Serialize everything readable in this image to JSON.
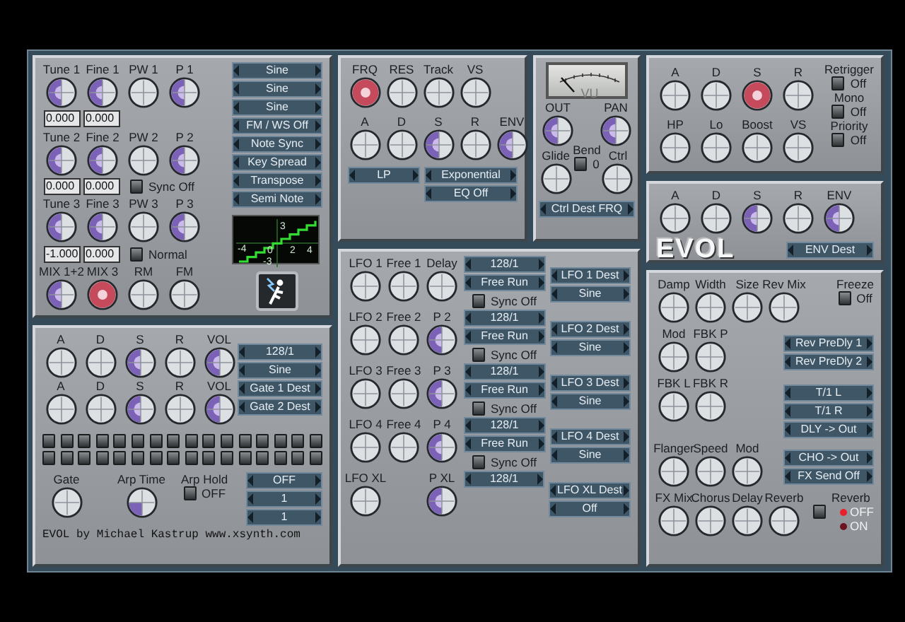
{
  "oscillator": {
    "rows": [
      {
        "knobs": [
          {
            "label": "Tune 1",
            "kind": "half"
          },
          {
            "label": "Fine 1",
            "kind": "half"
          },
          {
            "label": "PW 1",
            "kind": "plain"
          },
          {
            "label": "P 1",
            "kind": "half"
          }
        ],
        "values": [
          "0.000",
          "0.000"
        ]
      },
      {
        "knobs": [
          {
            "label": "Tune 2",
            "kind": "half"
          },
          {
            "label": "Fine 2",
            "kind": "half"
          },
          {
            "label": "PW 2",
            "kind": "plain"
          },
          {
            "label": "P 2",
            "kind": "half"
          }
        ],
        "values": [
          "0.000",
          "0.000"
        ],
        "toggle": {
          "state": "Sync Off",
          "checked": false
        }
      },
      {
        "knobs": [
          {
            "label": "Tune 3",
            "kind": "half"
          },
          {
            "label": "Fine 3",
            "kind": "half"
          },
          {
            "label": "PW 3",
            "kind": "plain"
          },
          {
            "label": "P 3",
            "kind": "half"
          }
        ],
        "values": [
          "-1.000",
          "0.000"
        ],
        "toggle": {
          "state": "Normal",
          "checked": false
        }
      },
      {
        "knobs": [
          {
            "label": "MIX 1+2",
            "kind": "half"
          },
          {
            "label": "MIX 3",
            "kind": "red"
          },
          {
            "label": "RM",
            "kind": "plain"
          },
          {
            "label": "FM",
            "kind": "plain"
          }
        ]
      }
    ],
    "selectors": [
      "Sine",
      "Sine",
      "Sine",
      "FM / WS Off",
      "Note Sync",
      "Key Spread",
      "Transpose",
      "Semi Note"
    ],
    "scope": {
      "labels": [
        "-4",
        "3",
        "0",
        "-3",
        "2",
        "4"
      ]
    }
  },
  "filter": {
    "knob_rows": [
      [
        {
          "label": "FRQ",
          "kind": "red"
        },
        {
          "label": "RES",
          "kind": "plain"
        },
        {
          "label": "Track",
          "kind": "plain"
        },
        {
          "label": "VS",
          "kind": "plain"
        }
      ],
      [
        {
          "label": "A",
          "kind": "plain"
        },
        {
          "label": "D",
          "kind": "plain"
        },
        {
          "label": "S",
          "kind": "half"
        },
        {
          "label": "R",
          "kind": "plain"
        },
        {
          "label": "ENV",
          "kind": "half"
        }
      ]
    ],
    "selectors": [
      "LP",
      "Exponential",
      "EQ Off"
    ]
  },
  "output": {
    "meter_label": "VU",
    "knobs": [
      {
        "label": "OUT",
        "kind": "half"
      },
      {
        "label": "PAN",
        "kind": "half"
      },
      {
        "label": "Glide",
        "kind": "plain"
      },
      {
        "label": "Ctrl",
        "kind": "plain"
      }
    ],
    "bend": {
      "label": "Bend",
      "state": "0",
      "checked": false
    },
    "selector": "Ctrl Dest FRQ"
  },
  "envelope": {
    "knob_rows": [
      [
        {
          "label": "A",
          "kind": "plain"
        },
        {
          "label": "D",
          "kind": "plain"
        },
        {
          "label": "S",
          "kind": "red"
        },
        {
          "label": "R",
          "kind": "plain"
        }
      ],
      [
        {
          "label": "HP",
          "kind": "plain"
        },
        {
          "label": "Lo",
          "kind": "plain"
        },
        {
          "label": "Boost",
          "kind": "plain"
        },
        {
          "label": "VS",
          "kind": "plain"
        }
      ]
    ],
    "toggles": [
      {
        "label": "Retrigger",
        "state": "Off",
        "checked": false
      },
      {
        "label": "Mono",
        "state": "Off",
        "checked": false
      },
      {
        "label": "Priority",
        "state": "Off",
        "checked": false
      }
    ]
  },
  "evol": {
    "knobs": [
      {
        "label": "A",
        "kind": "plain"
      },
      {
        "label": "D",
        "kind": "plain"
      },
      {
        "label": "S",
        "kind": "half"
      },
      {
        "label": "R",
        "kind": "plain"
      },
      {
        "label": "ENV",
        "kind": "half"
      }
    ],
    "logo": "EVOL",
    "selector": "ENV Dest"
  },
  "lfo": {
    "rows": [
      {
        "knobs": [
          {
            "label": "LFO 1",
            "kind": "plain"
          },
          {
            "label": "Free 1",
            "kind": "plain"
          },
          {
            "label": "Delay",
            "kind": "plain"
          }
        ],
        "rate": "128/1",
        "mode": "Free Run",
        "sync": {
          "state": "Sync Off",
          "checked": false
        },
        "dest": "LFO 1 Dest",
        "wave": "Sine"
      },
      {
        "knobs": [
          {
            "label": "LFO 2",
            "kind": "plain"
          },
          {
            "label": "Free 2",
            "kind": "plain"
          },
          {
            "label": "P 2",
            "kind": "half"
          }
        ],
        "rate": "128/1",
        "mode": "Free Run",
        "sync": {
          "state": "Sync Off",
          "checked": false
        },
        "dest": "LFO 2 Dest",
        "wave": "Sine"
      },
      {
        "knobs": [
          {
            "label": "LFO 3",
            "kind": "plain"
          },
          {
            "label": "Free 3",
            "kind": "plain"
          },
          {
            "label": "P 3",
            "kind": "half"
          }
        ],
        "rate": "128/1",
        "mode": "Free Run",
        "sync": {
          "state": "Sync Off",
          "checked": false
        },
        "dest": "LFO 3 Dest",
        "wave": "Sine"
      },
      {
        "knobs": [
          {
            "label": "LFO 4",
            "kind": "plain"
          },
          {
            "label": "Free 4",
            "kind": "plain"
          },
          {
            "label": "P 4",
            "kind": "half"
          }
        ],
        "rate": "128/1",
        "mode": "Free Run",
        "sync": {
          "state": "Sync Off",
          "checked": false
        },
        "dest": "LFO 4 Dest",
        "wave": "Sine"
      },
      {
        "knobs": [
          {
            "label": "LFO XL",
            "kind": "plain"
          },
          {
            "label": "P XL",
            "kind": "half"
          }
        ],
        "rate": "128/1",
        "dest": "LFO XL Dest",
        "wave": "Off"
      }
    ]
  },
  "arp": {
    "knob_rows": [
      [
        {
          "label": "A",
          "kind": "plain"
        },
        {
          "label": "D",
          "kind": "plain"
        },
        {
          "label": "S",
          "kind": "half"
        },
        {
          "label": "R",
          "kind": "plain"
        },
        {
          "label": "VOL",
          "kind": "half"
        }
      ],
      [
        {
          "label": "A",
          "kind": "plain"
        },
        {
          "label": "D",
          "kind": "plain"
        },
        {
          "label": "S",
          "kind": "half"
        },
        {
          "label": "R",
          "kind": "plain"
        },
        {
          "label": "VOL",
          "kind": "half"
        }
      ]
    ],
    "selectors": [
      "128/1",
      "Sine",
      "Gate 1 Dest",
      "Gate 2 Dest"
    ],
    "steps": [
      [
        false,
        false,
        false,
        false,
        false,
        false,
        false,
        false,
        false,
        false,
        false,
        false,
        false,
        false,
        false,
        false
      ],
      [
        false,
        false,
        false,
        false,
        false,
        false,
        false,
        false,
        false,
        false,
        false,
        false,
        false,
        false,
        false,
        false
      ]
    ],
    "gate_knob": {
      "label": "Gate",
      "kind": "plain"
    },
    "time_knob": {
      "label": "Arp Time",
      "kind": "quarter"
    },
    "hold": {
      "label": "Arp Hold",
      "state": "OFF",
      "checked": false
    },
    "hold_selectors": [
      "OFF",
      "1",
      "1"
    ],
    "credit": "EVOL by Michael Kastrup www.xsynth.com"
  },
  "fx": {
    "rows": [
      {
        "knobs": [
          {
            "label": "Damp",
            "kind": "plain"
          },
          {
            "label": "Width",
            "kind": "plain"
          },
          {
            "label": "Size",
            "kind": "plain"
          },
          {
            "label": "Rev Mix",
            "kind": "plain"
          }
        ],
        "side": [
          {
            "kind": "toggle",
            "label": "Freeze",
            "state": "Off",
            "checked": false
          }
        ]
      },
      {
        "knobs": [
          {
            "label": "Mod",
            "kind": "plain"
          },
          {
            "label": "FBK P",
            "kind": "plain"
          }
        ],
        "side": [
          {
            "kind": "selector",
            "text": "Rev PreDly 1"
          },
          {
            "kind": "selector",
            "text": "Rev PreDly 2"
          }
        ]
      },
      {
        "knobs": [
          {
            "label": "FBK L",
            "kind": "plain"
          },
          {
            "label": "FBK R",
            "kind": "plain"
          }
        ],
        "side": [
          {
            "kind": "selector",
            "text": "T/1 L"
          },
          {
            "kind": "selector",
            "text": "T/1 R"
          },
          {
            "kind": "selector",
            "text": "DLY -> Out"
          }
        ]
      },
      {
        "knobs": [
          {
            "label": "Flanger",
            "kind": "plain"
          },
          {
            "label": "Speed",
            "kind": "plain"
          },
          {
            "label": "Mod",
            "kind": "plain"
          }
        ],
        "side": [
          {
            "kind": "selector",
            "text": "CHO -> Out"
          },
          {
            "kind": "selector",
            "text": "FX Send Off"
          }
        ]
      },
      {
        "knobs": [
          {
            "label": "FX Mix",
            "kind": "plain"
          },
          {
            "label": "Chorus",
            "kind": "plain"
          },
          {
            "label": "Delay",
            "kind": "plain"
          },
          {
            "label": "Reverb",
            "kind": "plain"
          }
        ],
        "side": [
          {
            "kind": "toggle",
            "checked": false
          },
          {
            "kind": "radio",
            "label": "Reverb",
            "options": [
              {
                "label": "OFF",
                "selected": true
              },
              {
                "label": "ON",
                "selected": false
              }
            ]
          }
        ]
      }
    ]
  }
}
